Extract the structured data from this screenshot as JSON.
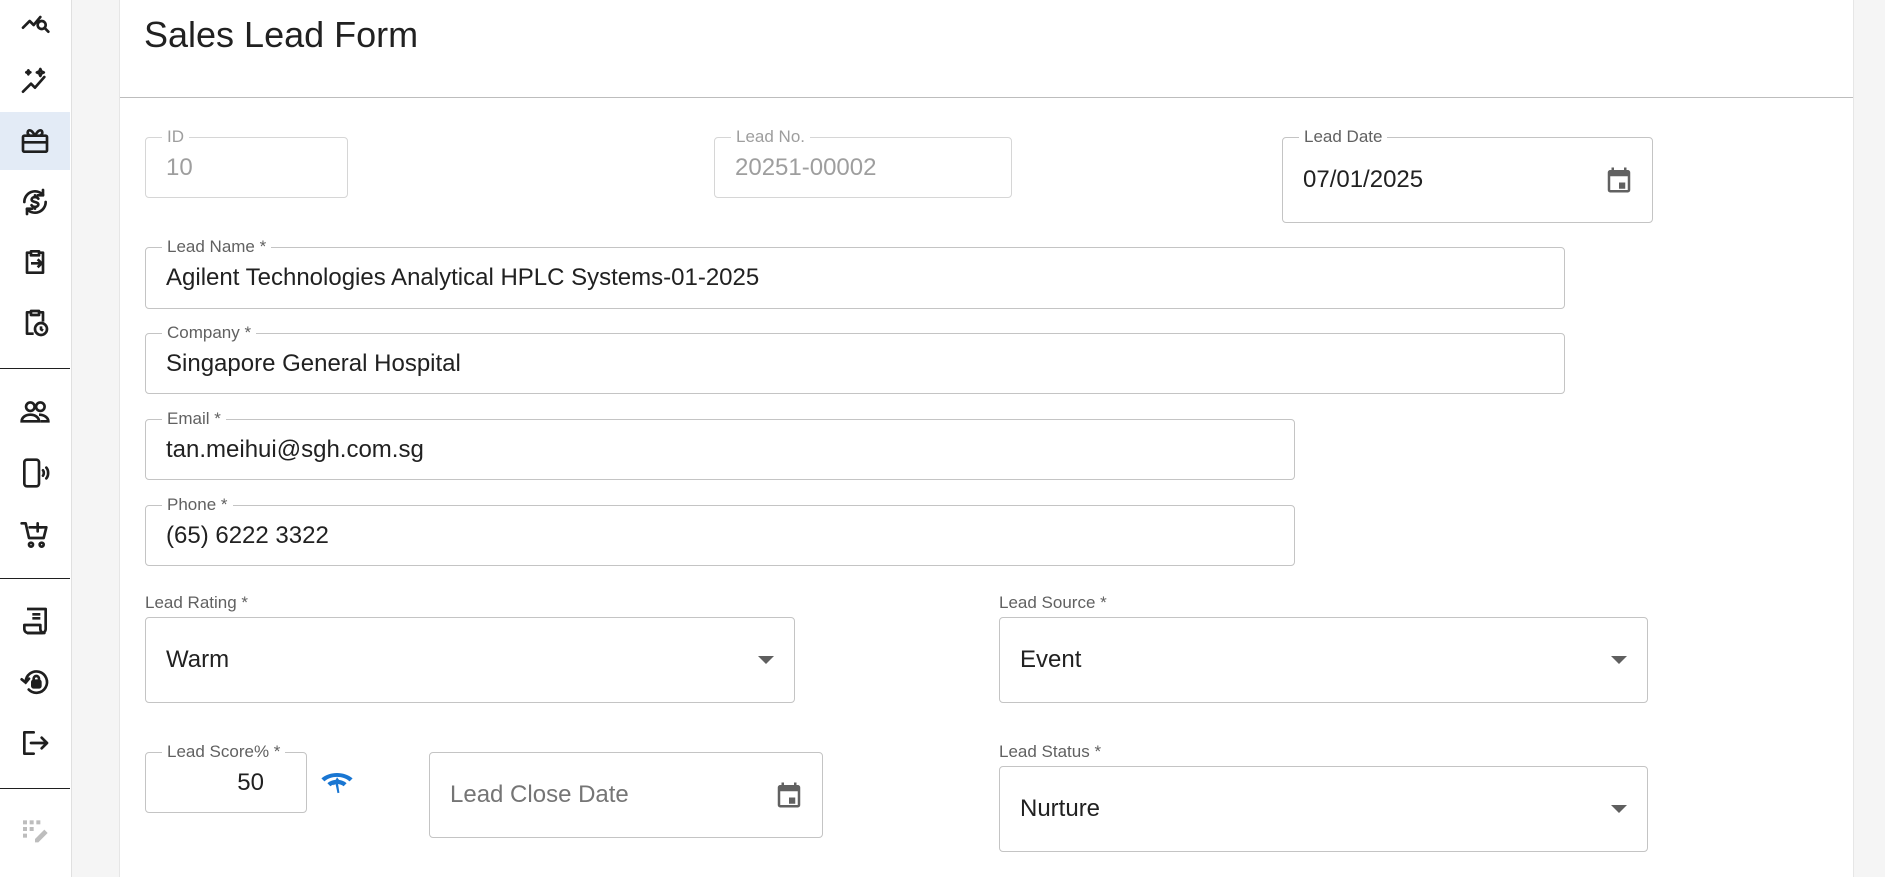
{
  "page": {
    "title": "Sales Lead Form"
  },
  "sidebar": {
    "items": [
      {
        "icon": "chart-search-icon"
      },
      {
        "icon": "sparkle-chart-icon"
      },
      {
        "icon": "gift-box-icon",
        "active": true
      },
      {
        "icon": "currency-cycle-icon"
      },
      {
        "icon": "clipboard-arrow-icon"
      },
      {
        "icon": "clipboard-clock-icon"
      },
      {
        "icon": "people-icon"
      },
      {
        "icon": "phone-vibrate-icon"
      },
      {
        "icon": "cart-add-icon"
      },
      {
        "icon": "receipt-icon"
      },
      {
        "icon": "lock-reset-icon"
      },
      {
        "icon": "logout-icon"
      },
      {
        "icon": "edit-grid-icon"
      }
    ]
  },
  "form": {
    "id": {
      "label": "ID",
      "value": "10"
    },
    "lead_no": {
      "label": "Lead No.",
      "value": "20251-00002"
    },
    "lead_date": {
      "label": "Lead Date",
      "value": "07/01/2025"
    },
    "lead_name": {
      "label": "Lead Name *",
      "value": "Agilent Technologies Analytical HPLC Systems-01-2025"
    },
    "company": {
      "label": "Company *",
      "value": "Singapore General Hospital"
    },
    "email": {
      "label": "Email *",
      "value": "tan.meihui@sgh.com.sg"
    },
    "phone": {
      "label": "Phone *",
      "value": "(65) 6222 3322"
    },
    "lead_rating": {
      "label": "Lead Rating *",
      "value": "Warm"
    },
    "lead_source": {
      "label": "Lead Source *",
      "value": "Event"
    },
    "lead_score": {
      "label": "Lead Score% *",
      "value": "50"
    },
    "lead_close_date": {
      "placeholder": "Lead Close Date"
    },
    "lead_status": {
      "label": "Lead Status *",
      "value": "Nurture"
    }
  },
  "colors": {
    "accent": "#1976d2",
    "active_nav_bg": "#e3ebf6"
  }
}
